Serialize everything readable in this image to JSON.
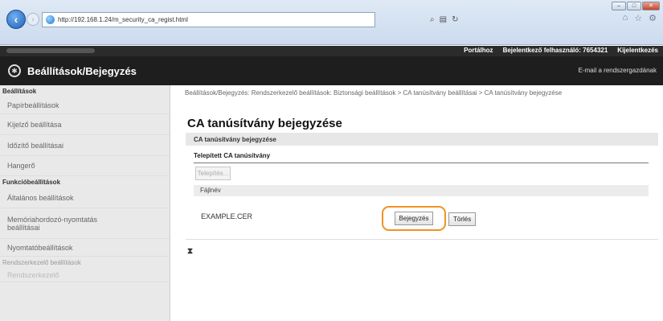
{
  "browser": {
    "url": "http://192.168.1.24/m_security_ca_regist.html",
    "window_buttons": {
      "minimize": "‒",
      "maximize": "□",
      "close": "✕"
    }
  },
  "topbar": {
    "links": [
      "Portálhoz",
      "Bejelentkező felhasználó: 7654321",
      "Kijelentkezés"
    ]
  },
  "header": {
    "title": "Beállítások/Bejegyzés",
    "mail_link": "E-mail a rendszergazdának"
  },
  "sidebar": {
    "sections": [
      {
        "heading": "Beállítások",
        "items": [
          "Papírbeállítások",
          "Kijelző beállítása",
          "Időzítő beállításai",
          "Hangerő"
        ]
      },
      {
        "heading": "Funkcióbeállítások",
        "items": [
          "Általános beállítások",
          "Memóriahordozó-nyomtatás beállításai",
          "Nyomtatóbeállítások"
        ]
      },
      {
        "heading": "Rendszerkezelő beállítások",
        "items": [
          "Rendszerkezelő"
        ]
      }
    ]
  },
  "main": {
    "breadcrumb": "Beállítások/Bejegyzés: Rendszerkezelő beállítások: Biztonsági beállítások > CA tanúsítvány beállításai > CA tanúsítvány bejegyzése",
    "title": "CA tanúsítvány bejegyzése",
    "section": "CA tanúsítvány bejegyzése",
    "installed_heading": "Telepített CA tanúsítvány",
    "install_button": "Telepítés...",
    "file_column": "Fájlnév",
    "file_name": "EXAMPLE.CER",
    "register_button": "Bejegyzés",
    "delete_button": "Törlés",
    "top_link": "⧗"
  }
}
